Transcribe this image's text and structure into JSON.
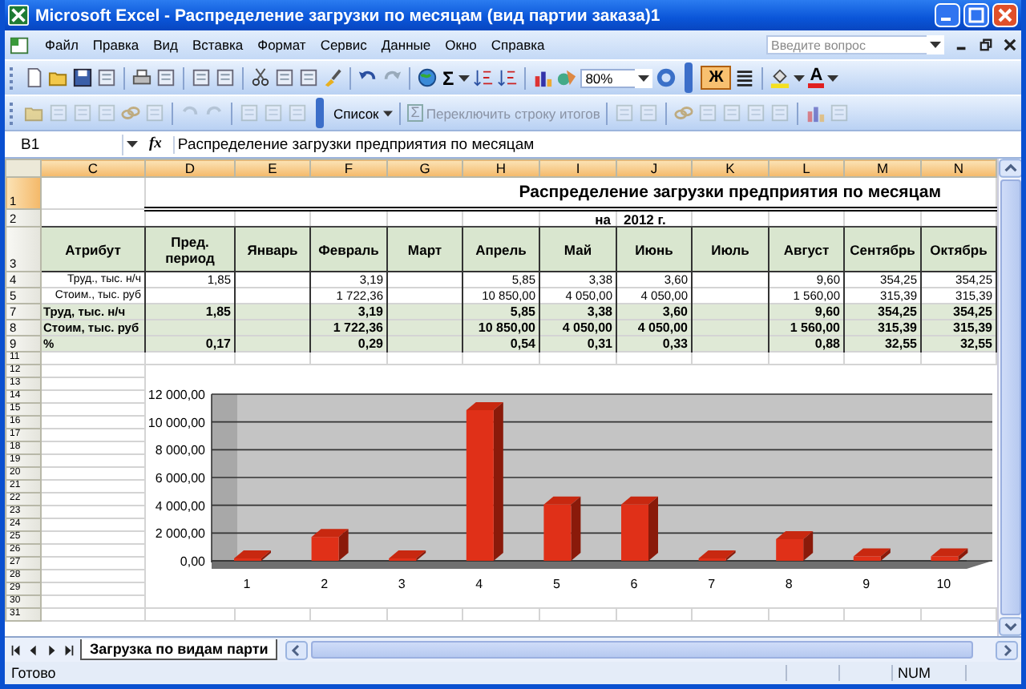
{
  "window": {
    "title": "Microsoft Excel - Распределение загрузки по месяцам (вид партии заказа)1"
  },
  "menu": {
    "items": [
      "Файл",
      "Правка",
      "Вид",
      "Вставка",
      "Формат",
      "Сервис",
      "Данные",
      "Окно",
      "Справка"
    ],
    "help_search": {
      "placeholder": "Введите вопрос"
    }
  },
  "standard_toolbar": {
    "sum_label": "Σ",
    "zoom": "80%",
    "bold_button": {
      "label": "Ж",
      "pressed": true
    },
    "font_color_label": "A"
  },
  "list_toolbar": {
    "list_button": "Список",
    "total_row_button": {
      "icon_label": "Σ",
      "label": "Переключить строку итогов",
      "disabled": true
    }
  },
  "formula_bar": {
    "cell_ref": "B1",
    "function_label": "fx",
    "content": "Распределение загрузки предприятия по месяцам"
  },
  "sheet": {
    "columns": [
      {
        "letter": "C",
        "selected": true
      },
      {
        "letter": "D",
        "selected": true
      },
      {
        "letter": "E",
        "selected": true
      },
      {
        "letter": "F",
        "selected": true
      },
      {
        "letter": "G",
        "selected": true
      },
      {
        "letter": "H",
        "selected": true
      },
      {
        "letter": "I",
        "selected": true
      },
      {
        "letter": "J",
        "selected": true
      },
      {
        "letter": "K",
        "selected": true
      },
      {
        "letter": "L",
        "selected": true
      },
      {
        "letter": "M",
        "selected": true
      },
      {
        "letter": "N",
        "selected": true
      }
    ],
    "rows": [
      {
        "number": "1",
        "selected": true,
        "kind": "title",
        "cells": {
          "D": "Распределение загрузки предприятия по месяцам"
        }
      },
      {
        "number": "2",
        "selected": false,
        "kind": "subtitle",
        "cells": {
          "I": "на",
          "J": "2012 г."
        }
      },
      {
        "number": "3",
        "selected": false,
        "kind": "header",
        "cells": {
          "C": "Атрибут",
          "D": "Пред. период",
          "E": "Январь",
          "F": "Февраль",
          "G": "Март",
          "H": "Апрель",
          "I": "Май",
          "J": "Июнь",
          "K": "Июль",
          "L": "Август",
          "M": "Сентябрь",
          "N": "Октябрь"
        }
      },
      {
        "number": "4",
        "selected": false,
        "kind": "detail",
        "cells": {
          "C": "Труд., тыс. н/ч",
          "D": "1,85",
          "F": "3,19",
          "H": "5,85",
          "I": "3,38",
          "J": "3,60",
          "L": "9,60",
          "M": "354,25",
          "N": "354,25"
        }
      },
      {
        "number": "5",
        "selected": false,
        "kind": "detail",
        "cells": {
          "C": "Стоим., тыс. руб",
          "F": "1 722,36",
          "H": "10 850,00",
          "I": "4 050,00",
          "J": "4 050,00",
          "L": "1 560,00",
          "M": "315,39",
          "N": "315,39"
        }
      },
      {
        "number": "7",
        "selected": false,
        "kind": "total",
        "cells": {
          "C": "Труд, тыс. н/ч",
          "D": "1,85",
          "F": "3,19",
          "H": "5,85",
          "I": "3,38",
          "J": "3,60",
          "L": "9,60",
          "M": "354,25",
          "N": "354,25"
        }
      },
      {
        "number": "8",
        "selected": false,
        "kind": "total",
        "cells": {
          "C": "Стоим, тыс. руб",
          "F": "1 722,36",
          "H": "10 850,00",
          "I": "4 050,00",
          "J": "4 050,00",
          "L": "1 560,00",
          "M": "315,39",
          "N": "315,39"
        }
      },
      {
        "number": "9",
        "selected": false,
        "kind": "total",
        "cells": {
          "C": "%",
          "D": "0,17",
          "F": "0,29",
          "H": "0,54",
          "I": "0,31",
          "J": "0,33",
          "L": "0,88",
          "M": "32,55",
          "N": "32,55"
        }
      },
      {
        "number": "11",
        "selected": false,
        "kind": "blank"
      },
      {
        "number": "12",
        "selected": false,
        "kind": "chart"
      },
      {
        "number": "13",
        "selected": false,
        "kind": "chart"
      },
      {
        "number": "14",
        "selected": false,
        "kind": "chart"
      },
      {
        "number": "15",
        "selected": false,
        "kind": "chart"
      },
      {
        "number": "16",
        "selected": false,
        "kind": "chart"
      },
      {
        "number": "17",
        "selected": false,
        "kind": "chart"
      },
      {
        "number": "18",
        "selected": false,
        "kind": "chart"
      },
      {
        "number": "19",
        "selected": false,
        "kind": "chart"
      },
      {
        "number": "20",
        "selected": false,
        "kind": "chart"
      },
      {
        "number": "21",
        "selected": false,
        "kind": "chart"
      },
      {
        "number": "22",
        "selected": false,
        "kind": "chart"
      },
      {
        "number": "23",
        "selected": false,
        "kind": "chart"
      },
      {
        "number": "24",
        "selected": false,
        "kind": "chart"
      },
      {
        "number": "25",
        "selected": false,
        "kind": "chart"
      },
      {
        "number": "26",
        "selected": false,
        "kind": "chart"
      },
      {
        "number": "27",
        "selected": false,
        "kind": "chart"
      },
      {
        "number": "28",
        "selected": false,
        "kind": "chart"
      },
      {
        "number": "29",
        "selected": false,
        "kind": "chart"
      },
      {
        "number": "30",
        "selected": false,
        "kind": "chart"
      },
      {
        "number": "31",
        "selected": false,
        "kind": "blank"
      }
    ],
    "chart_data": {
      "type": "bar",
      "categories": [
        "1",
        "2",
        "3",
        "4",
        "5",
        "6",
        "7",
        "8",
        "9",
        "10"
      ],
      "values": [
        0,
        1720,
        0,
        10850,
        4050,
        4050,
        0,
        1560,
        320,
        320
      ],
      "ylim": [
        0,
        12000
      ],
      "yticks": [
        {
          "value": 0,
          "label": "0,00"
        },
        {
          "value": 2000,
          "label": "2 000,00"
        },
        {
          "value": 4000,
          "label": "4 000,00"
        },
        {
          "value": 6000,
          "label": "6 000,00"
        },
        {
          "value": 8000,
          "label": "8 000,00"
        },
        {
          "value": 10000,
          "label": "10 000,00"
        },
        {
          "value": 12000,
          "label": "12 000,00"
        }
      ]
    }
  },
  "sheet_tabs": [
    {
      "label": "Загрузка по видам парти",
      "selected": true
    }
  ],
  "status_bar": {
    "left": "Готово",
    "indicator": "NUM"
  }
}
